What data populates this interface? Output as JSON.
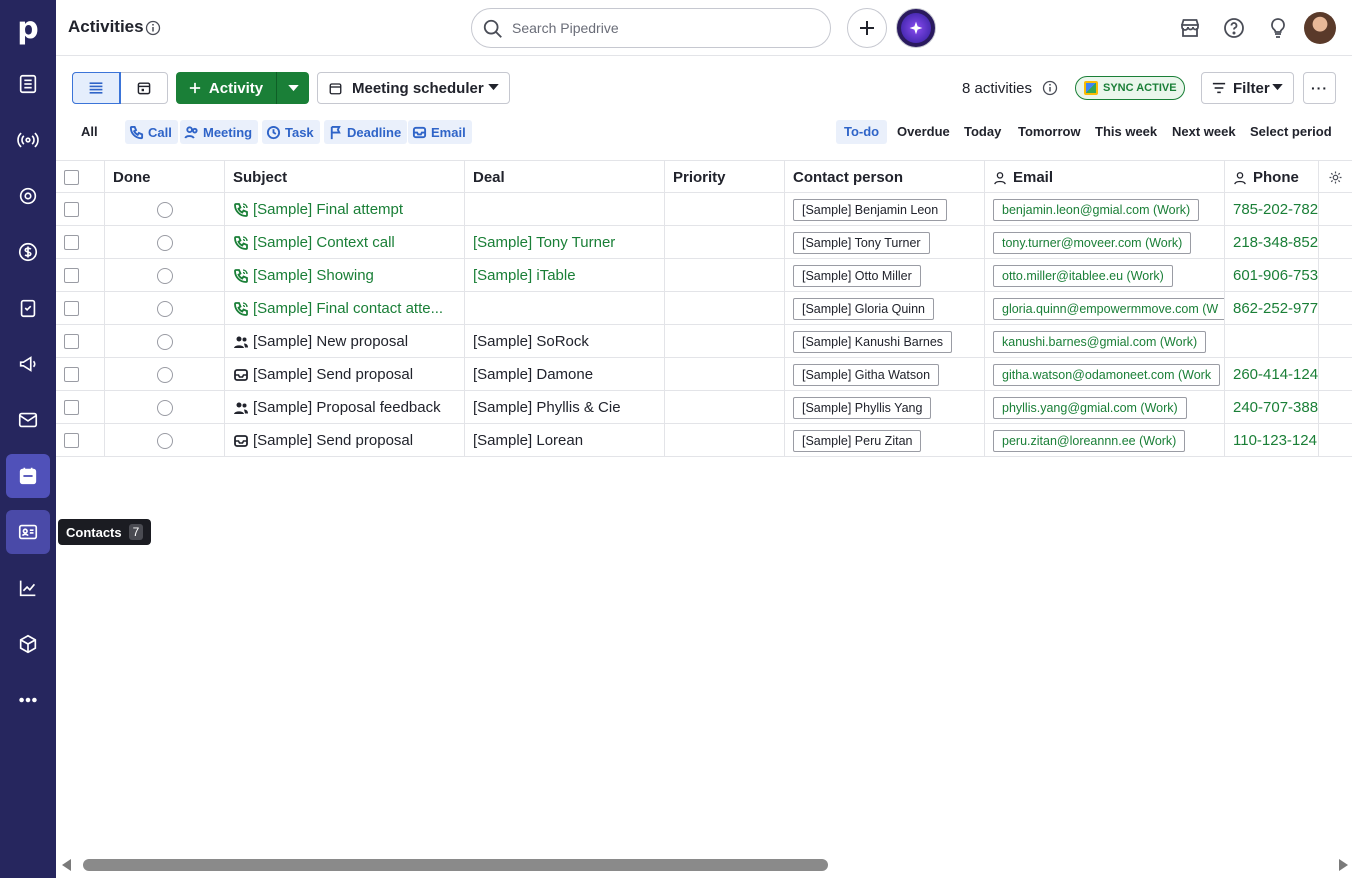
{
  "app": {
    "logo_letter": "p"
  },
  "sidebar": {
    "tooltip": {
      "label": "Contacts",
      "shortcut": "7"
    }
  },
  "header": {
    "title": "Activities",
    "search_placeholder": "Search Pipedrive"
  },
  "toolbar": {
    "activity_label": "Activity",
    "scheduler_label": "Meeting scheduler",
    "count_text": "8 activities",
    "sync_label": "SYNC ACTIVE",
    "filter_label": "Filter",
    "more_label": "···"
  },
  "type_filters": {
    "all": "All",
    "types": [
      "Call",
      "Meeting",
      "Task",
      "Deadline",
      "Email"
    ]
  },
  "periods": [
    "To-do",
    "Overdue",
    "Today",
    "Tomorrow",
    "This week",
    "Next week",
    "Select period"
  ],
  "table": {
    "headers": [
      "Done",
      "Subject",
      "Deal",
      "Priority",
      "Contact person",
      "Email",
      "Phone"
    ],
    "rows": [
      {
        "type": "call",
        "subject": "[Sample] Final attempt",
        "deal": "",
        "contact": "[Sample] Benjamin Leon",
        "email": "benjamin.leon@gmial.com (Work)",
        "phone": "785-202-782"
      },
      {
        "type": "call",
        "subject": "[Sample] Context call",
        "deal": "[Sample] Tony Turner",
        "contact": "[Sample] Tony Turner",
        "email": "tony.turner@moveer.com (Work)",
        "phone": "218-348-852"
      },
      {
        "type": "call",
        "subject": "[Sample] Showing",
        "deal": "[Sample] iTable",
        "contact": "[Sample] Otto Miller",
        "email": "otto.miller@itablee.eu (Work)",
        "phone": "601-906-753"
      },
      {
        "type": "call",
        "subject": "[Sample] Final contact atte...",
        "deal": "",
        "contact": "[Sample] Gloria Quinn",
        "email": "gloria.quinn@empowermmove.com (W",
        "phone": "862-252-977"
      },
      {
        "type": "meeting",
        "subject": "[Sample] New proposal",
        "deal": "[Sample] SoRock",
        "contact": "[Sample] Kanushi Barnes",
        "email": "kanushi.barnes@gmial.com (Work)",
        "phone": ""
      },
      {
        "type": "email",
        "subject": "[Sample] Send proposal",
        "deal": "[Sample] Damone",
        "contact": "[Sample] Githa Watson",
        "email": "githa.watson@odamoneet.com (Work",
        "phone": "260-414-124"
      },
      {
        "type": "meeting",
        "subject": "[Sample] Proposal feedback",
        "deal": "[Sample] Phyllis & Cie",
        "contact": "[Sample] Phyllis Yang",
        "email": "phyllis.yang@gmial.com (Work)",
        "phone": "240-707-388"
      },
      {
        "type": "email",
        "subject": "[Sample] Send proposal",
        "deal": "[Sample] Lorean",
        "contact": "[Sample] Peru Zitan",
        "email": "peru.zitan@loreannn.ee (Work)",
        "phone": "110-123-124"
      }
    ]
  },
  "colors": {
    "sidebar": "#26265e",
    "active_nav": "#5051b9",
    "accent_green": "#1a7f37",
    "link_blue": "#2f64c8"
  }
}
